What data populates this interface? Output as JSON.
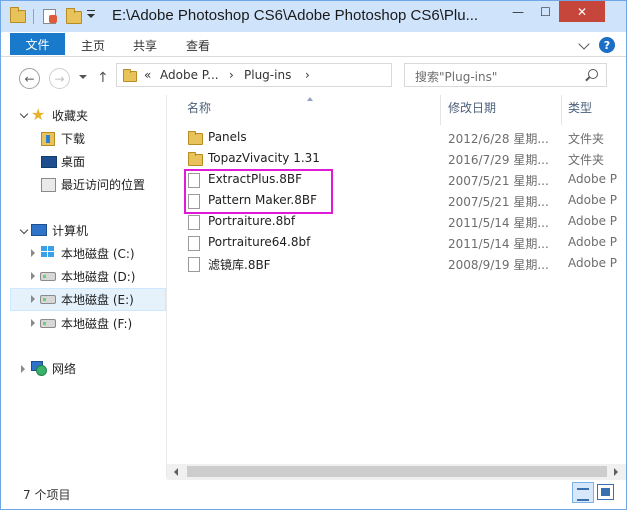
{
  "window": {
    "title": "E:\\Adobe Photoshop CS6\\Adobe Photoshop CS6\\Plu...",
    "controls": {
      "minimize": "—",
      "maximize": "☐",
      "close": "✕"
    }
  },
  "ribbon": {
    "file_tab": "文件",
    "tabs": [
      "主页",
      "共享",
      "查看"
    ],
    "help": "?"
  },
  "address": {
    "prefix": "«",
    "path": [
      "Adobe P...",
      "Plug-ins"
    ],
    "separator": "›"
  },
  "search": {
    "placeholder": "搜索\"Plug-ins\""
  },
  "navpane": {
    "favorites": "收藏夹",
    "favorites_items": [
      "下载",
      "桌面",
      "最近访问的位置"
    ],
    "computer": "计算机",
    "drives": [
      "本地磁盘 (C:)",
      "本地磁盘 (D:)",
      "本地磁盘 (E:)",
      "本地磁盘 (F:)"
    ],
    "network": "网络",
    "selected_drive": "本地磁盘 (E:)"
  },
  "columns": {
    "name": "名称",
    "date": "修改日期",
    "type": "类型"
  },
  "files": [
    {
      "name": "Panels",
      "date": "2012/6/28 星期...",
      "type": "文件夹",
      "kind": "folder"
    },
    {
      "name": "TopazVivacity 1.31",
      "date": "2016/7/29 星期...",
      "type": "文件夹",
      "kind": "folder"
    },
    {
      "name": "ExtractPlus.8BF",
      "date": "2007/5/21 星期...",
      "type": "Adobe P",
      "kind": "file"
    },
    {
      "name": "Pattern Maker.8BF",
      "date": "2007/5/21 星期...",
      "type": "Adobe P",
      "kind": "file"
    },
    {
      "name": "Portraiture.8bf",
      "date": "2011/5/14 星期...",
      "type": "Adobe P",
      "kind": "file"
    },
    {
      "name": "Portraiture64.8bf",
      "date": "2011/5/14 星期...",
      "type": "Adobe P",
      "kind": "file"
    },
    {
      "name": "滤镜库.8BF",
      "date": "2008/9/19 星期...",
      "type": "Adobe P",
      "kind": "file"
    }
  ],
  "status": {
    "count": "7 个项目"
  },
  "colors": {
    "accent": "#1979ca",
    "highlight": "#e01ad9",
    "selection": "#e5f1fb"
  }
}
